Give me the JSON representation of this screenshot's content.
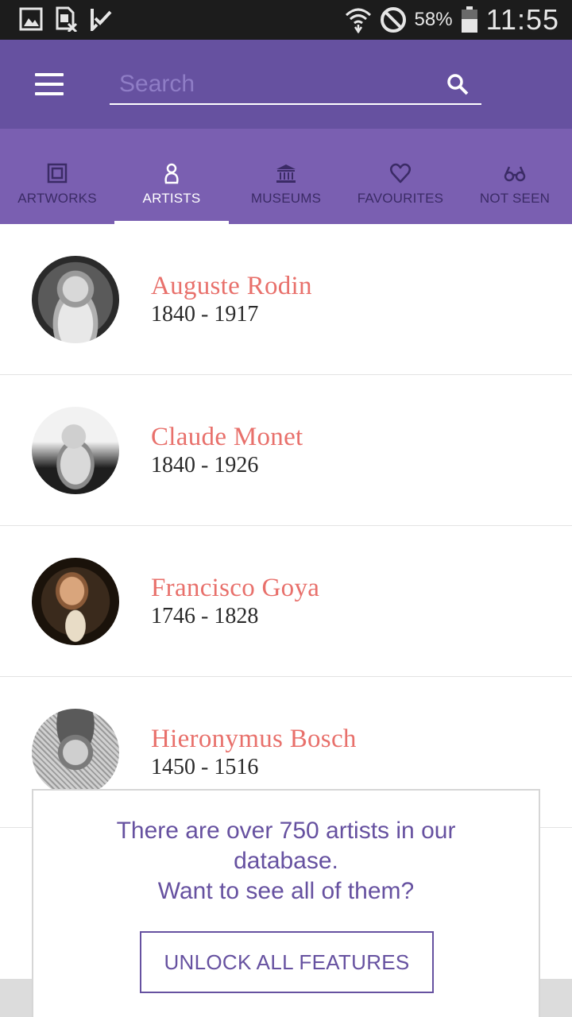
{
  "status_bar": {
    "battery_percent": "58%",
    "time": "11:55",
    "icons": [
      "image-icon",
      "sim-card-off-icon",
      "task-check-icon",
      "wifi-icon",
      "do-not-disturb-icon",
      "battery-icon"
    ]
  },
  "toolbar": {
    "menu_icon": "hamburger-menu-icon",
    "search_placeholder": "Search",
    "search_icon": "search-icon"
  },
  "tabs": [
    {
      "label": "ARTWORKS",
      "icon": "frame-icon",
      "active": false
    },
    {
      "label": "ARTISTS",
      "icon": "person-icon",
      "active": true
    },
    {
      "label": "MUSEUMS",
      "icon": "museum-icon",
      "active": false
    },
    {
      "label": "FAVOURITES",
      "icon": "heart-icon",
      "active": false
    },
    {
      "label": "NOT SEEN",
      "icon": "glasses-icon",
      "active": false
    }
  ],
  "artists": [
    {
      "name": "Auguste Rodin",
      "years": "1840 - 1917"
    },
    {
      "name": "Claude Monet",
      "years": "1840 - 1926"
    },
    {
      "name": "Francisco Goya",
      "years": "1746 - 1828"
    },
    {
      "name": "Hieronymus Bosch",
      "years": "1450 - 1516"
    }
  ],
  "promo": {
    "line1": "There are over 750 artists in our",
    "line2": "database.",
    "line3": "Want to see all of them?",
    "button_label": "UNLOCK ALL FEATURES"
  },
  "colors": {
    "toolbar": "#6651a0",
    "tabs": "#7a5fb1",
    "artist_name": "#e8706b",
    "accent_text": "#6651a0"
  }
}
